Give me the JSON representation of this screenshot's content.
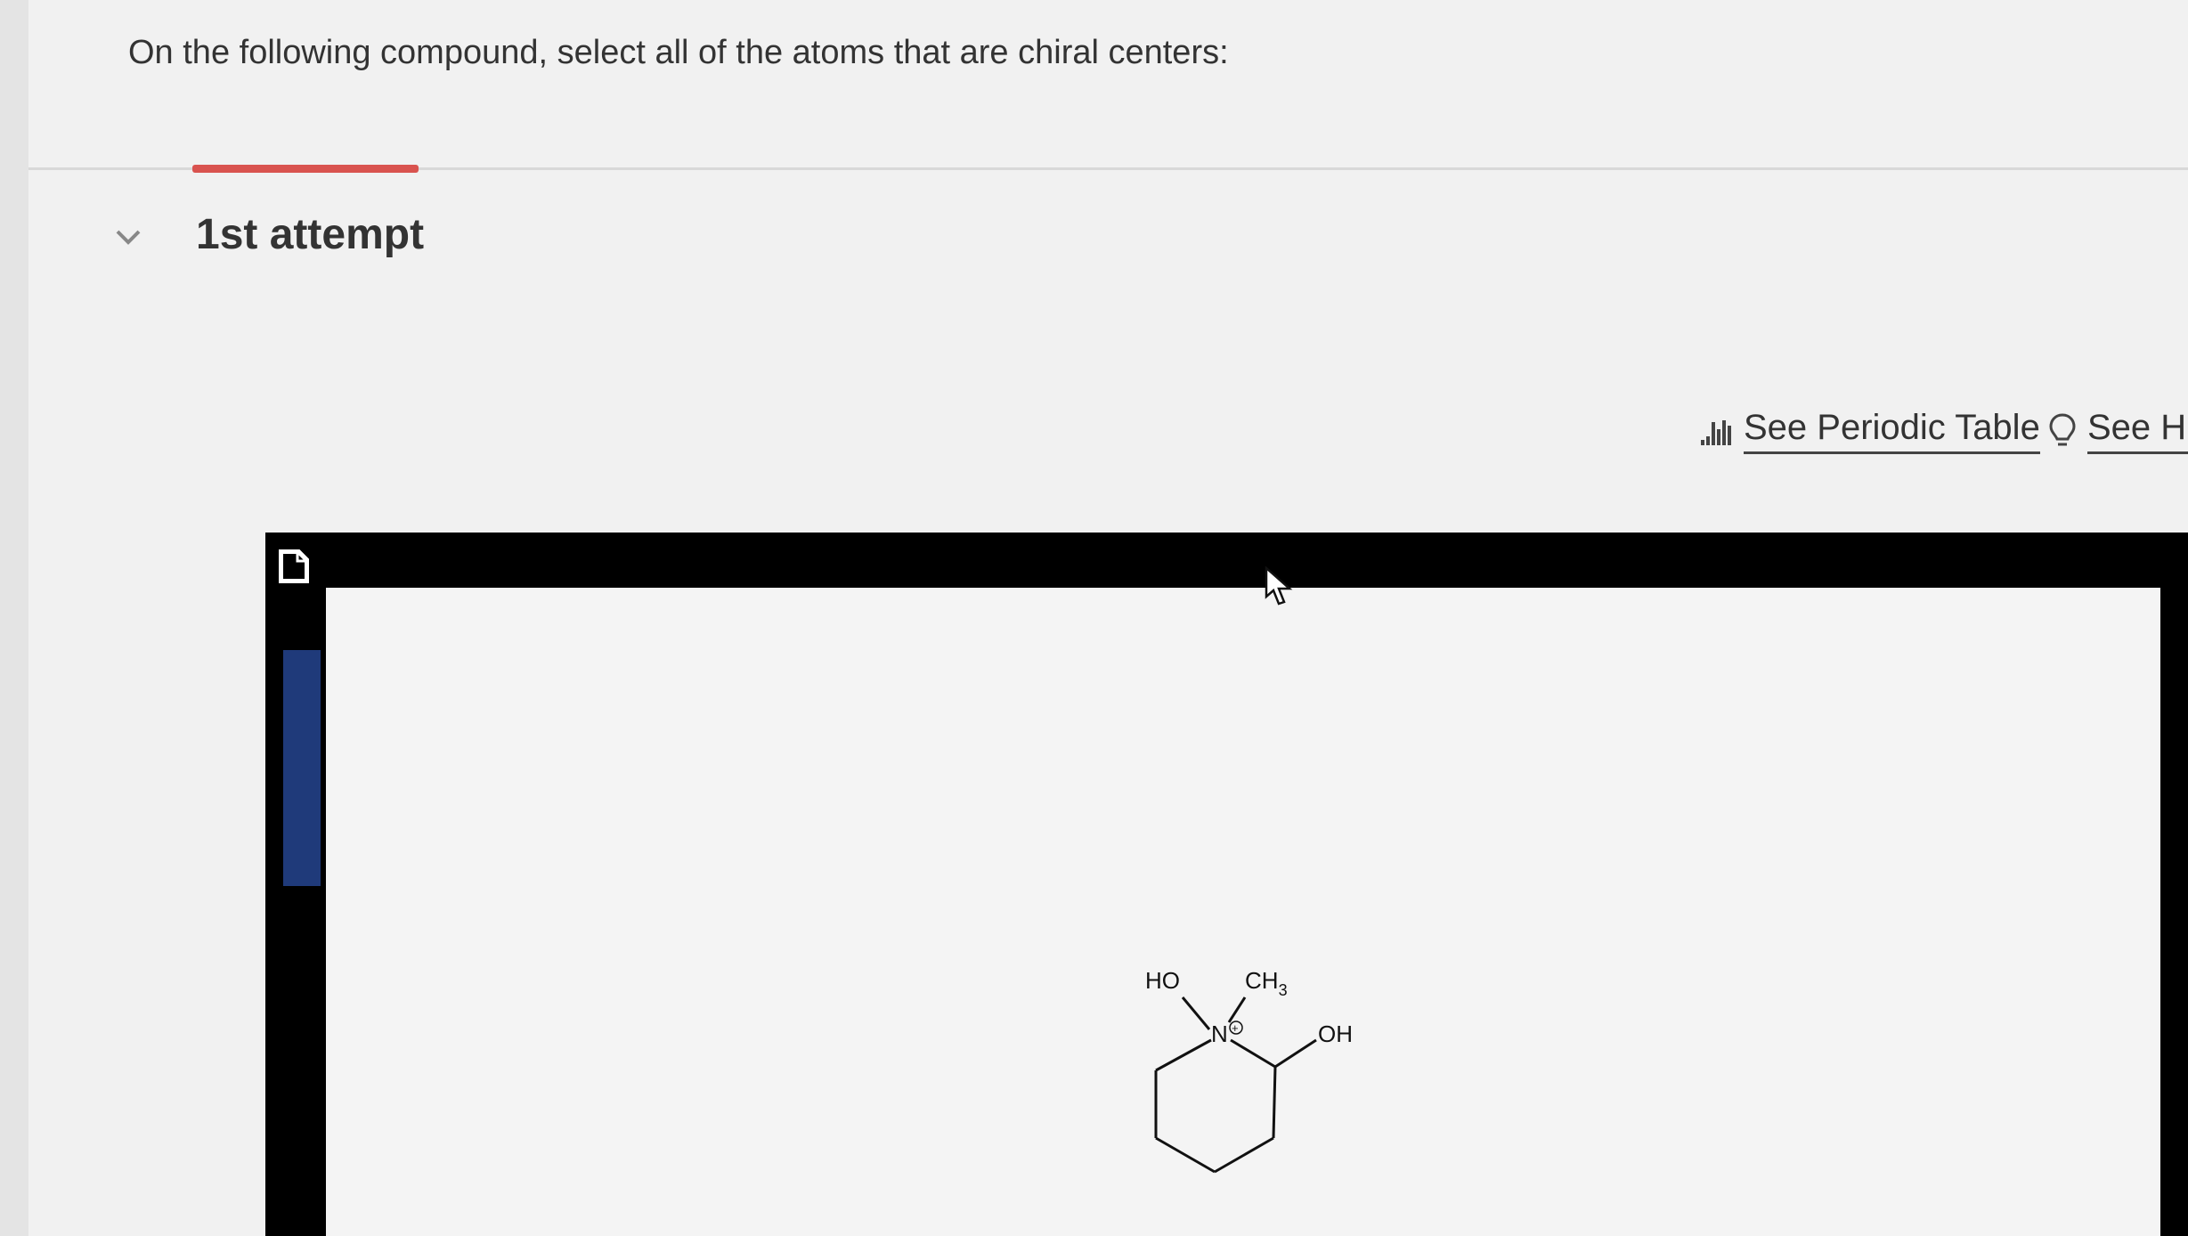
{
  "question": {
    "text": "On the following compound, select all of the atoms that are chiral centers:"
  },
  "attempt": {
    "label": "1st attempt"
  },
  "links": {
    "periodic_table": "See Periodic Table",
    "hint": "See Hint"
  },
  "molecule": {
    "labels": {
      "ho": "HO",
      "ch": "CH",
      "ch_sub": "3",
      "n": "N",
      "charge": "+",
      "oh": "OH"
    }
  },
  "colors": {
    "progress": "#d9534f",
    "editor_frame": "#000000",
    "accent": "#1f3a7a"
  },
  "icons": [
    "chevron-down-icon",
    "periodic-table-icon",
    "lightbulb-icon",
    "document-icon",
    "cursor-icon"
  ]
}
